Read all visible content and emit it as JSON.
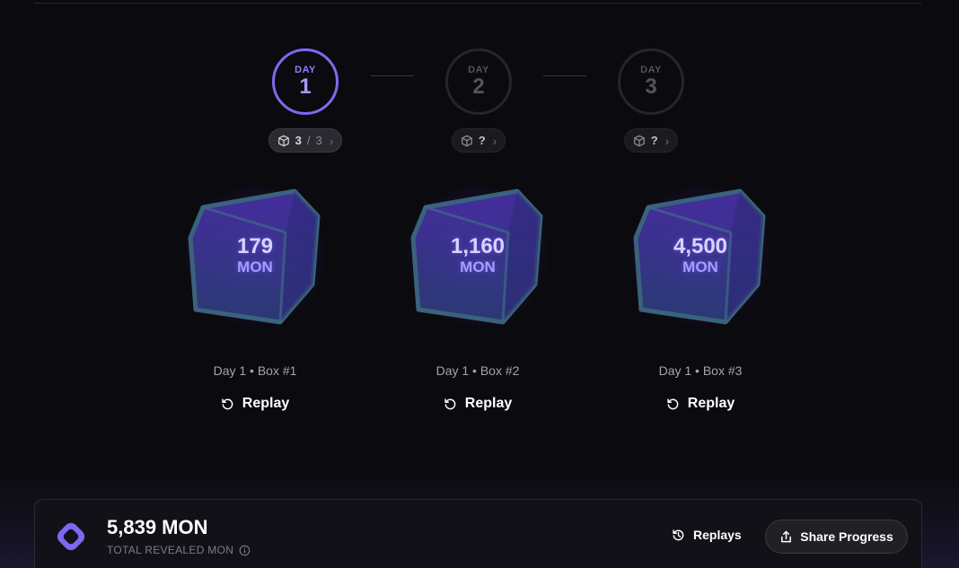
{
  "days": [
    {
      "label": "DAY",
      "number": "1",
      "count": "3",
      "sep": "/",
      "total": "3",
      "active": true
    },
    {
      "label": "DAY",
      "number": "2",
      "count": "?",
      "active": false
    },
    {
      "label": "DAY",
      "number": "3",
      "count": "?",
      "active": false
    }
  ],
  "boxes": [
    {
      "amount": "179",
      "unit": "MON",
      "caption": "Day 1 • Box #1",
      "replay_label": "Replay"
    },
    {
      "amount": "1,160",
      "unit": "MON",
      "caption": "Day 1 • Box #2",
      "replay_label": "Replay"
    },
    {
      "amount": "4,500",
      "unit": "MON",
      "caption": "Day 1 • Box #3",
      "replay_label": "Replay"
    }
  ],
  "footer": {
    "total_amount": "5,839 MON",
    "total_label": "TOTAL REVEALED MON",
    "replays_label": "Replays",
    "share_label": "Share Progress"
  },
  "colors": {
    "accent": "#7f68f0",
    "background": "#0b0a0e"
  },
  "icons": [
    "cube-icon",
    "chevron-right-icon",
    "replay-icon",
    "info-icon",
    "history-icon",
    "share-icon",
    "monad-logo-icon"
  ]
}
